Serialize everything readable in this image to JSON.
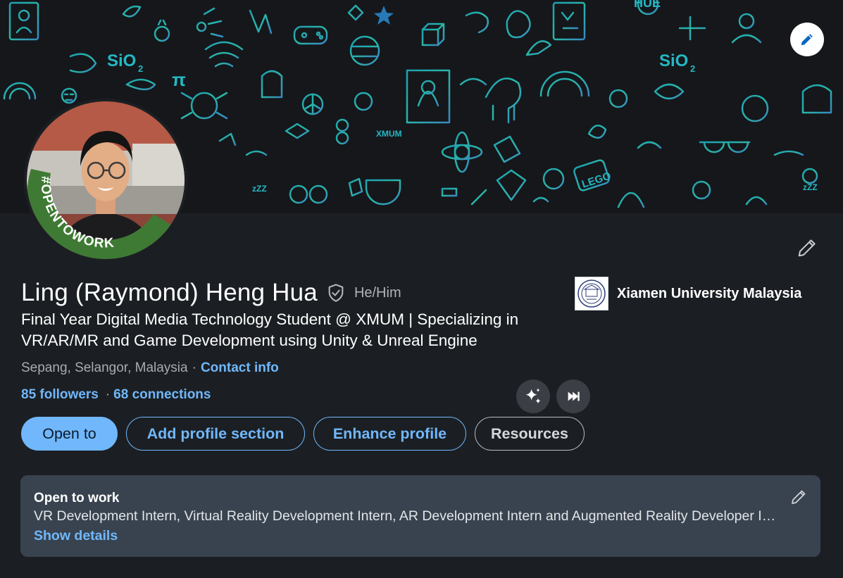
{
  "banner": {
    "doodle_text": [
      "SiO",
      "2",
      "π",
      "LEGO",
      "zZZ",
      "XMUM",
      "HUE",
      "SiO",
      "2",
      "zZZ"
    ],
    "edit_icon": "pencil-icon"
  },
  "profile": {
    "name": "Ling (Raymond) Heng Hua",
    "pronouns": "He/Him",
    "badge_text": "#OPENTOWORK",
    "headline": "Final Year Digital Media Technology Student @ XMUM | Specializing in VR/AR/MR and Game Development using Unity & Unreal Engine",
    "location": "Sepang, Selangor, Malaysia",
    "location_separator": "·",
    "contact_info_label": "Contact info",
    "followers_label": "85 followers",
    "stats_separator": "·",
    "connections_label": "68 connections"
  },
  "organization": {
    "name": "Xiamen University Malaysia"
  },
  "actions": {
    "open_to": "Open to",
    "add_section": "Add profile section",
    "enhance": "Enhance profile",
    "resources": "Resources"
  },
  "open_to_work": {
    "title": "Open to work",
    "description": "VR Development Intern, Virtual Reality Development Intern, AR Development Intern and Augmented Reality Developer Intern",
    "show_details": "Show details"
  },
  "colors": {
    "page_bg": "#1b1f23",
    "accent_blue": "#71b7fb",
    "card_bg": "#38434f",
    "opentowork_green": "#3f7a34",
    "doodle_teal": "#25b8c4"
  }
}
